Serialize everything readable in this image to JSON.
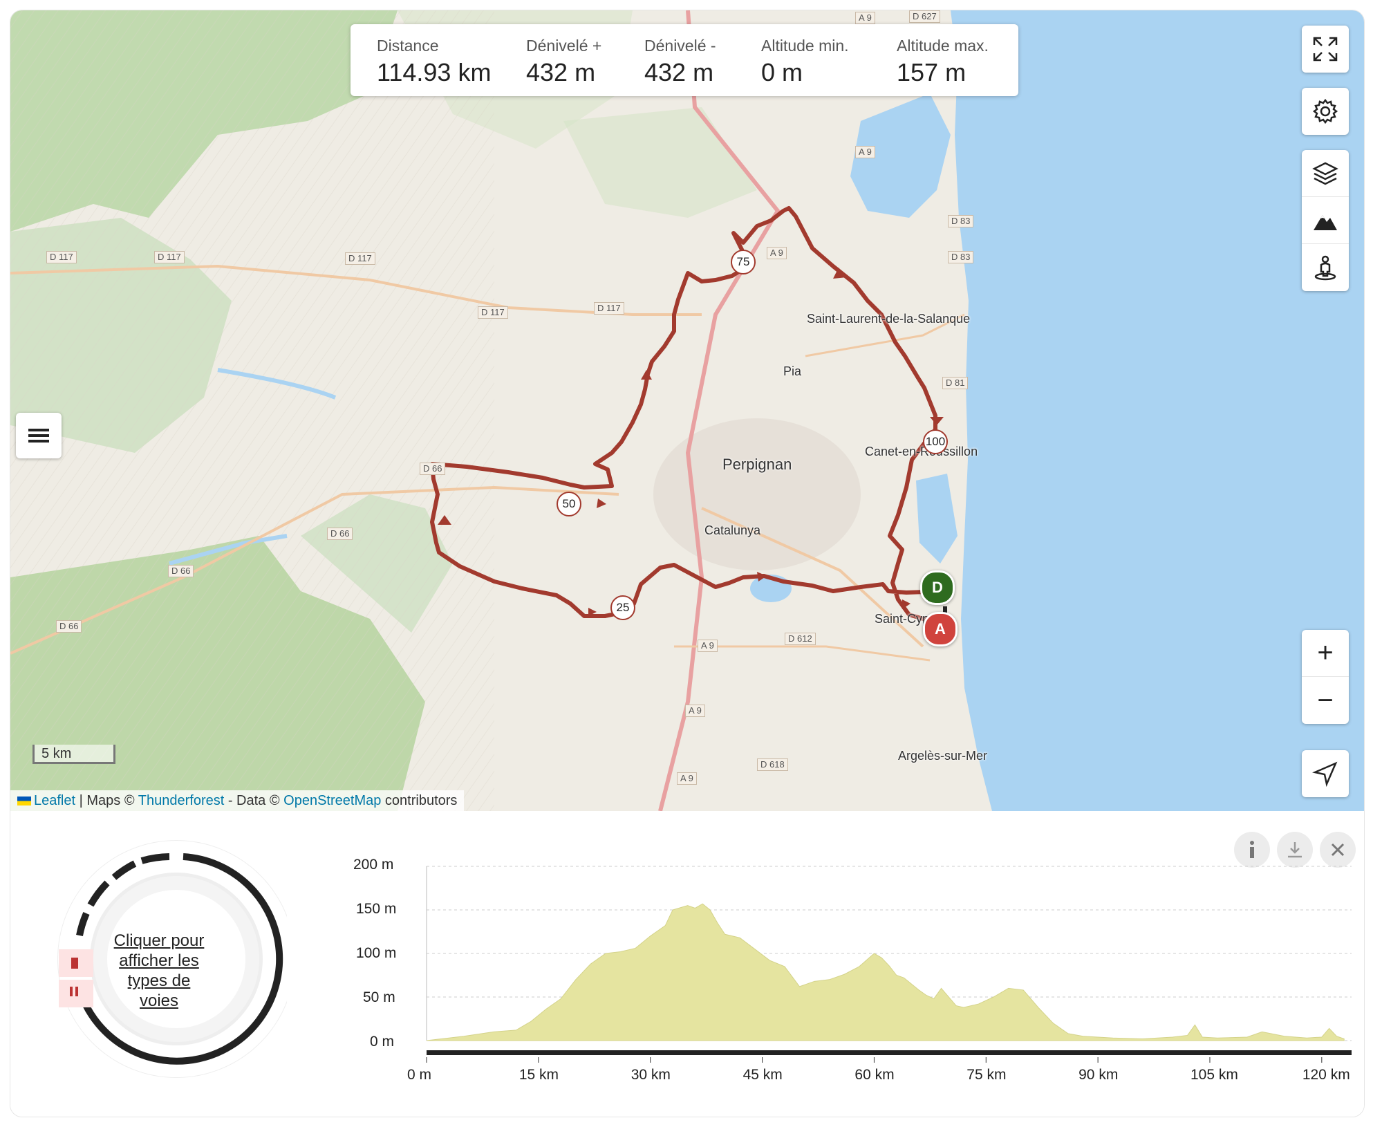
{
  "stats": [
    {
      "label": "Distance",
      "value": "114.93 km"
    },
    {
      "label": "Dénivelé +",
      "value": "432 m"
    },
    {
      "label": "Dénivelé -",
      "value": "432 m"
    },
    {
      "label": "Altitude min.",
      "value": "0 m"
    },
    {
      "label": "Altitude max.",
      "value": "157 m"
    }
  ],
  "map": {
    "places": [
      {
        "name": "Saint-Laurent-de-la-Salanque",
        "big": false
      },
      {
        "name": "Pia",
        "big": false
      },
      {
        "name": "Perpignan",
        "big": true
      },
      {
        "name": "Canet-en-Roussillon",
        "big": false
      },
      {
        "name": "Catalunya",
        "big": false
      },
      {
        "name": "Saint-Cyprien",
        "big": false
      },
      {
        "name": "Argelès-sur-Mer",
        "big": false
      }
    ],
    "roads": [
      "A 9",
      "D 627",
      "D 83",
      "D 81",
      "D 117",
      "D 66",
      "D 612",
      "D 618",
      "D 612"
    ],
    "km_markers": [
      "25",
      "50",
      "75",
      "100"
    ],
    "start_label": "D",
    "end_label": "A",
    "scale": "5 km",
    "attribution": {
      "leaflet": "Leaflet",
      "sep1": " | Maps © ",
      "thunderforest": "Thunderforest",
      "sep2": " - Data © ",
      "osm": "OpenStreetMap",
      "tail": " contributors"
    }
  },
  "controls": {
    "top": [
      "fullscreen-icon",
      "settings-icon"
    ],
    "layers": [
      "layers-icon",
      "terrain-icon",
      "streetview-icon"
    ],
    "zoom": [
      "+",
      "−"
    ],
    "locate": "locate-icon"
  },
  "road_types": {
    "link_text": "Cliquer pour afficher les types de voies"
  },
  "chart_data": {
    "type": "area",
    "xlabel": "",
    "ylabel": "",
    "ylim": [
      0,
      200
    ],
    "xlim": [
      0,
      124
    ],
    "y_ticks": [
      "200 m",
      "150 m",
      "100 m",
      "50 m",
      "0 m"
    ],
    "x_ticks": [
      "0 m",
      "15 km",
      "30 km",
      "45 km",
      "60 km",
      "75 km",
      "90 km",
      "105 km",
      "120 km"
    ],
    "x": [
      0,
      2,
      5,
      9,
      12,
      14,
      16,
      18,
      20,
      22,
      24,
      26,
      28,
      30,
      32,
      33,
      35,
      36,
      37,
      38,
      39,
      40,
      42,
      44,
      46,
      48,
      50,
      52,
      54,
      56,
      58,
      60,
      61,
      62,
      63,
      64,
      66,
      67,
      68,
      69,
      71,
      72,
      74,
      76,
      78,
      80,
      82,
      84,
      86,
      88,
      92,
      96,
      100,
      102,
      103,
      104,
      106,
      110,
      112,
      115,
      118,
      120,
      121,
      122,
      123
    ],
    "y": [
      0,
      2,
      5,
      10,
      12,
      22,
      36,
      48,
      70,
      88,
      100,
      102,
      106,
      120,
      132,
      150,
      155,
      152,
      157,
      150,
      135,
      122,
      118,
      105,
      92,
      85,
      62,
      68,
      70,
      76,
      85,
      100,
      95,
      86,
      75,
      72,
      58,
      52,
      48,
      60,
      40,
      38,
      42,
      50,
      60,
      58,
      38,
      20,
      8,
      5,
      3,
      2,
      4,
      6,
      18,
      4,
      3,
      4,
      10,
      5,
      3,
      4,
      14,
      5,
      2
    ]
  }
}
